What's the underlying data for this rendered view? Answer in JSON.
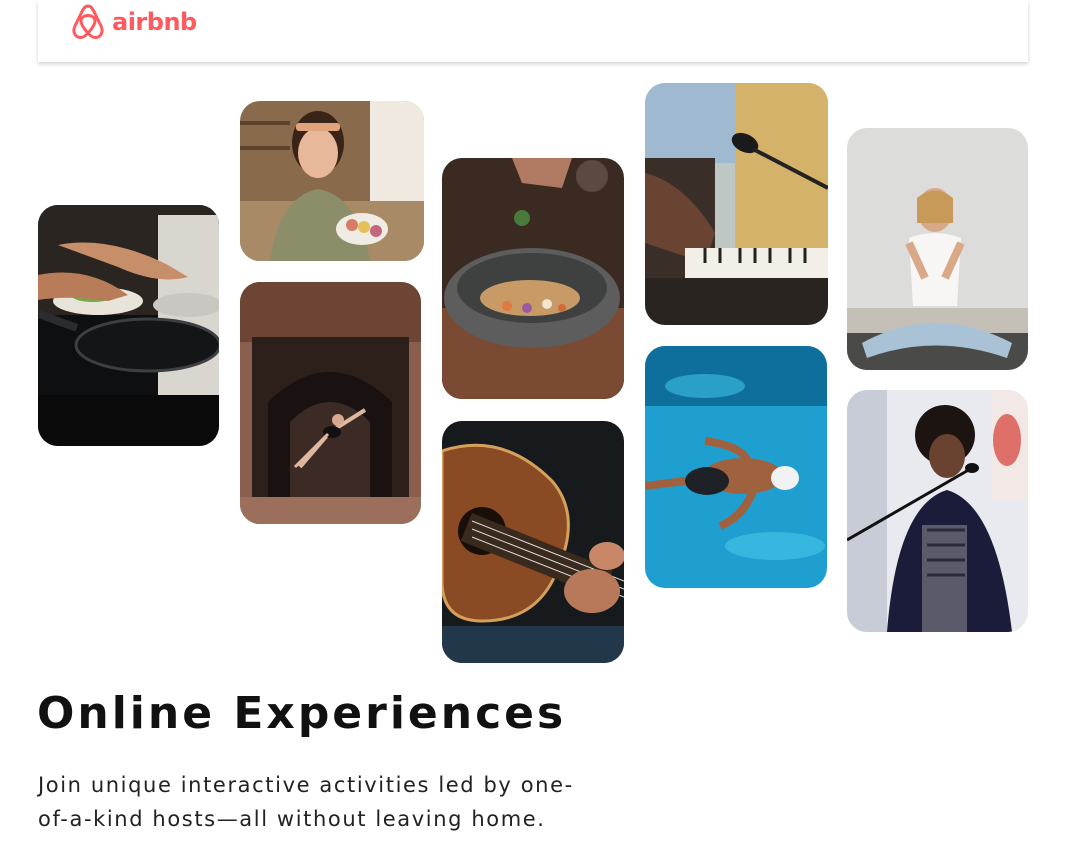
{
  "header": {
    "logo_text": "airbnb",
    "logo_icon": "airbnb-belo-icon",
    "brand_color": "#ff5a5f"
  },
  "gallery": {
    "photos": [
      {
        "name": "cooking-class-photo",
        "icon": "cooking-pan-image"
      },
      {
        "name": "macaron-host-photo",
        "icon": "macaron-baker-image"
      },
      {
        "name": "dancer-doorway-photo",
        "icon": "ballet-dancer-image"
      },
      {
        "name": "stone-bowl-food-photo",
        "icon": "mortar-bowl-image"
      },
      {
        "name": "acoustic-guitar-photo",
        "icon": "guitar-image"
      },
      {
        "name": "keyboard-microphone-photo",
        "icon": "piano-microphone-image"
      },
      {
        "name": "swimmer-pool-photo",
        "icon": "swimmer-image"
      },
      {
        "name": "meditation-yoga-photo",
        "icon": "yoga-meditation-image"
      },
      {
        "name": "singer-microphone-photo",
        "icon": "singer-image"
      }
    ]
  },
  "hero": {
    "title": "Online Experiences",
    "subtitle": "Join unique interactive activities led by one-of-a-kind hosts—all without leaving home."
  }
}
